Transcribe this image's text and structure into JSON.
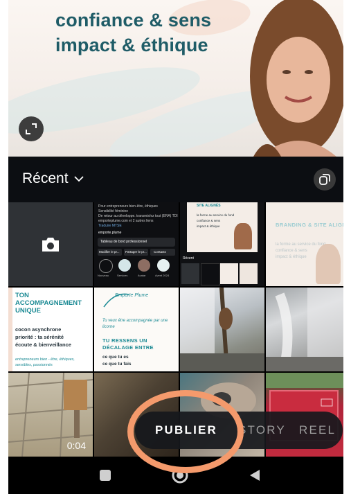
{
  "preview": {
    "line1": "confiance & sens",
    "line2": "impact & éthique",
    "expand_icon": "expand-icon"
  },
  "toolbar": {
    "album_label": "Récent",
    "album_chevron_icon": "chevron-down-icon",
    "multi_select_icon": "multi-select-icon"
  },
  "grid": {
    "camera_icon": "camera-icon",
    "ig_screenshot": {
      "bio_lines": [
        "Pour entrepreneurs bien-être, éthiques",
        "Sensibilité féminine",
        "De retour au développe. transmis/ez tout (ERA) TDI",
        "emporteplume.com et 2 autres liens",
        "Traduire MTSE"
      ],
      "handle": "emporte.plume",
      "dashboard_label": "Tableau de bord professionnel",
      "buttons": [
        "Modifier le pr...",
        "Partager le pr...",
        "Contacts"
      ],
      "highlights": [
        "Nouveau",
        "Services",
        "Avatar",
        "Avent 2024"
      ],
      "recent_label": "Récent",
      "post_line1": "SITE ALIGNÉS",
      "post_line2": "la forme au service du fond",
      "post_line3": "confiance & sens",
      "post_line4": "impact & éthique"
    },
    "branding_post": {
      "title": "BRANDING & SITE ALIGNÉS",
      "line1": "la forme au service du fond",
      "line2": "confiance & sens",
      "line3": "impact & éthique"
    },
    "accompagnement_post": {
      "title": "TON ACCOMPAGNEMENT UNIQUE",
      "line1": "cocon asynchrone",
      "line2": "priorité : ta sérénité",
      "line3": "écoute & bienveillance",
      "footer": "entrepreneurs bien - être, éthiques, sensibles, passionnés"
    },
    "emporte_post": {
      "logo_text": "Emporte Plume",
      "line1": "Tu veux être accompagnée par une licorne",
      "title": "TU RESSENS UN DÉCALAGE ENTRE",
      "line2": "ce que tu es",
      "line3": "ce que tu fais"
    },
    "video_duration": "0:04"
  },
  "modes": {
    "publish": "PUBLIER",
    "story": "STORY",
    "reel": "REEL"
  },
  "nav": {
    "recents_icon": "recents-square-icon",
    "home_icon": "home-circle-icon",
    "back_icon": "back-triangle-icon"
  },
  "colors": {
    "accent_teal": "#1b8a94",
    "highlight_ring": "#f49a6c"
  }
}
